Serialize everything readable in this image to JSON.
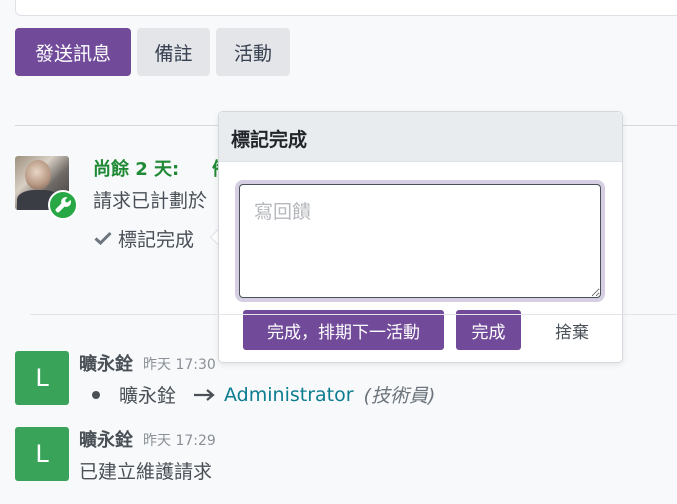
{
  "chatter": {
    "send_message": "發送訊息",
    "log_note": "備註",
    "activity": "活動"
  },
  "activity": {
    "due_label": "尚餘 2 天:",
    "activity_type": "備",
    "summary": "請求已計劃於",
    "mark_done": "標記完成",
    "badge_icon": "wrench-icon",
    "badge_color": "#28a745"
  },
  "popover": {
    "title": "標記完成",
    "feedback_placeholder": "寫回饋",
    "done_schedule_next": "完成，排期下一活動",
    "done": "完成",
    "discard": "捨棄"
  },
  "messages": [
    {
      "avatar_letter": "L",
      "author": "曠永銓",
      "time": "昨天 17:30",
      "tracking": {
        "old_value": "曠永銓",
        "new_value": "Administrator",
        "field": "(技術員)"
      }
    },
    {
      "avatar_letter": "L",
      "author": "曠永銓",
      "time": "昨天 17:29",
      "body": "已建立維護請求"
    }
  ],
  "colors": {
    "primary": "#714b9a",
    "success": "#28a745",
    "avatar_green": "#3aa35a",
    "link": "#0c7c90"
  }
}
